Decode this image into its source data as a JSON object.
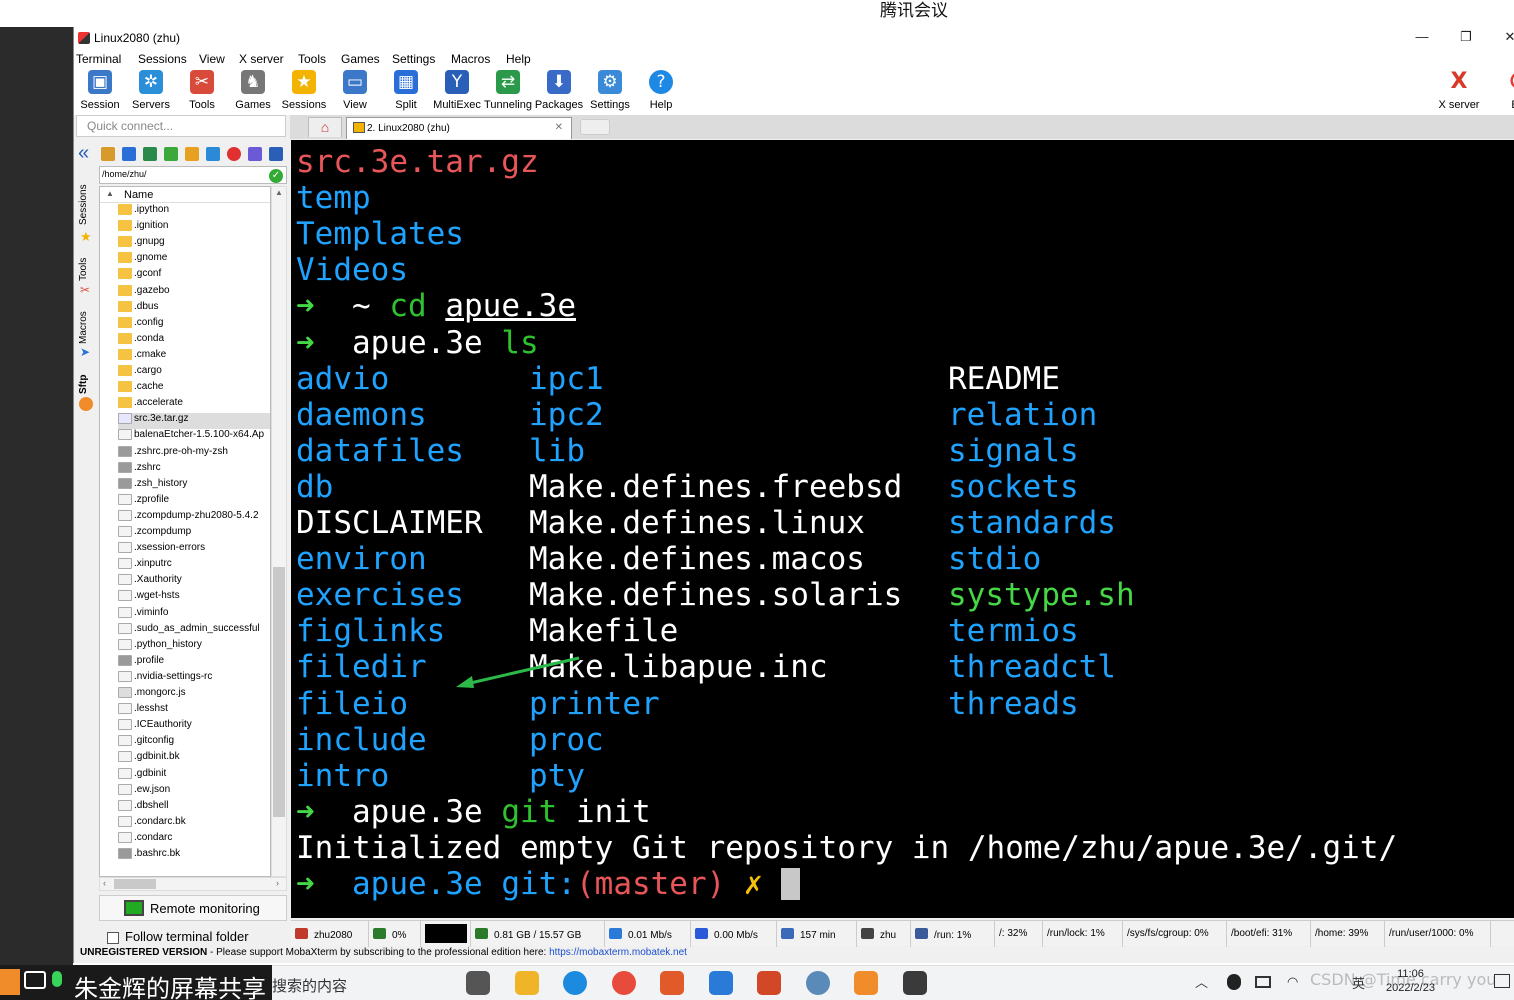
{
  "meeting": {
    "title": "腾讯会议"
  },
  "window": {
    "title": "Linux2080 (zhu)",
    "min": "—",
    "restore": "❐",
    "close": "✕"
  },
  "menu": [
    "Terminal",
    "Sessions",
    "View",
    "X server",
    "Tools",
    "Games",
    "Settings",
    "Macros",
    "Help"
  ],
  "toolbar": [
    {
      "label": "Session",
      "icon": "monitor-icon",
      "color": "#3b78c8",
      "glyph": "▣"
    },
    {
      "label": "Servers",
      "icon": "servers-icon",
      "color": "#2a8fd8",
      "glyph": "✲"
    },
    {
      "label": "Tools",
      "icon": "tools-icon",
      "color": "#d84a3a",
      "glyph": "✂"
    },
    {
      "label": "Games",
      "icon": "games-icon",
      "color": "#777777",
      "glyph": "♞"
    },
    {
      "label": "Sessions",
      "icon": "star-icon",
      "color": "#f2b400",
      "glyph": "★"
    },
    {
      "label": "View",
      "icon": "view-icon",
      "color": "#3b78c8",
      "glyph": "▭"
    },
    {
      "label": "Split",
      "icon": "split-icon",
      "color": "#2a6fd8",
      "glyph": "▦"
    },
    {
      "label": "MultiExec",
      "icon": "multiexec-icon",
      "color": "#2a5fb8",
      "glyph": "Y"
    },
    {
      "label": "Tunneling",
      "icon": "tunneling-icon",
      "color": "#2a9a4a",
      "glyph": "⇄"
    },
    {
      "label": "Packages",
      "icon": "packages-icon",
      "color": "#3a6ac8",
      "glyph": "⬇"
    },
    {
      "label": "Settings",
      "icon": "settings-icon",
      "color": "#3a8ad8",
      "glyph": "⚙"
    },
    {
      "label": "Help",
      "icon": "help-icon",
      "color": "#1e88e5",
      "glyph": "?"
    }
  ],
  "toolbar_right": [
    {
      "label": "X server",
      "icon": "xserver-icon",
      "glyph": "X",
      "color": "#d83a2a"
    },
    {
      "label": "Exi",
      "icon": "exit-icon",
      "glyph": "⏻",
      "color": "#e33b2e"
    }
  ],
  "quick_connect": {
    "placeholder": "Quick connect..."
  },
  "tabs": {
    "session_tab": "2. Linux2080 (zhu)",
    "close": "✕",
    "home": "⌂"
  },
  "side_tabs": [
    "Sessions",
    "Tools",
    "Macros",
    "Sftp"
  ],
  "sftp": {
    "path": "/home/zhu/",
    "column": "Name",
    "files": [
      {
        "name": ".ipython",
        "type": "folder"
      },
      {
        "name": ".ignition",
        "type": "folder"
      },
      {
        "name": ".gnupg",
        "type": "folder"
      },
      {
        "name": ".gnome",
        "type": "folder"
      },
      {
        "name": ".gconf",
        "type": "folder"
      },
      {
        "name": ".gazebo",
        "type": "folder"
      },
      {
        "name": ".dbus",
        "type": "folder"
      },
      {
        "name": ".config",
        "type": "folder"
      },
      {
        "name": ".conda",
        "type": "folder"
      },
      {
        "name": ".cmake",
        "type": "folder"
      },
      {
        "name": ".cargo",
        "type": "folder"
      },
      {
        "name": ".cache",
        "type": "folder"
      },
      {
        "name": ".accelerate",
        "type": "folder"
      },
      {
        "name": "src.3e.tar.gz",
        "type": "archive"
      },
      {
        "name": "balenaEtcher-1.5.100-x64.Ap",
        "type": "file"
      },
      {
        "name": ".zshrc.pre-oh-my-zsh",
        "type": "gray"
      },
      {
        "name": ".zshrc",
        "type": "gray"
      },
      {
        "name": ".zsh_history",
        "type": "gray"
      },
      {
        "name": ".zprofile",
        "type": "file"
      },
      {
        "name": ".zcompdump-zhu2080-5.4.2",
        "type": "file"
      },
      {
        "name": ".zcompdump",
        "type": "file"
      },
      {
        "name": ".xsession-errors",
        "type": "file"
      },
      {
        "name": ".xinputrc",
        "type": "file"
      },
      {
        "name": ".Xauthority",
        "type": "file"
      },
      {
        "name": ".wget-hsts",
        "type": "file"
      },
      {
        "name": ".viminfo",
        "type": "file"
      },
      {
        "name": ".sudo_as_admin_successful",
        "type": "file"
      },
      {
        "name": ".python_history",
        "type": "file"
      },
      {
        "name": ".profile",
        "type": "gray"
      },
      {
        "name": ".nvidia-settings-rc",
        "type": "file"
      },
      {
        "name": ".mongorc.js",
        "type": "js"
      },
      {
        "name": ".lesshst",
        "type": "file"
      },
      {
        "name": ".ICEauthority",
        "type": "file"
      },
      {
        "name": ".gitconfig",
        "type": "file"
      },
      {
        "name": ".gdbinit.bk",
        "type": "file"
      },
      {
        "name": ".gdbinit",
        "type": "file"
      },
      {
        "name": ".ew.json",
        "type": "file"
      },
      {
        "name": ".dbshell",
        "type": "file"
      },
      {
        "name": ".condarc.bk",
        "type": "file"
      },
      {
        "name": ".condarc",
        "type": "file"
      },
      {
        "name": ".bashrc.bk",
        "type": "gray"
      }
    ],
    "remote_monitoring": "Remote monitoring",
    "follow_folder": "Follow terminal folder"
  },
  "terminal": {
    "top_lines": [
      {
        "text": "src.3e.tar.gz",
        "color": "red"
      },
      {
        "text": "temp",
        "color": "cyan"
      },
      {
        "text": "Templates",
        "color": "cyan"
      },
      {
        "text": "Videos",
        "color": "cyan"
      }
    ],
    "prompt_arrow": "➜",
    "home_tilde": "~",
    "cd_cmd": "cd",
    "cd_arg": "apue.3e",
    "dir": "apue.3e",
    "ls_cmd": "ls",
    "ls_rows": [
      [
        {
          "t": "advio",
          "c": "cyan"
        },
        {
          "t": "ipc1",
          "c": "cyan"
        },
        {
          "t": "README",
          "c": "wht"
        }
      ],
      [
        {
          "t": "daemons",
          "c": "cyan"
        },
        {
          "t": "ipc2",
          "c": "cyan"
        },
        {
          "t": "relation",
          "c": "cyan"
        }
      ],
      [
        {
          "t": "datafiles",
          "c": "cyan"
        },
        {
          "t": "lib",
          "c": "cyan"
        },
        {
          "t": "signals",
          "c": "cyan"
        }
      ],
      [
        {
          "t": "db",
          "c": "cyan"
        },
        {
          "t": "Make.defines.freebsd",
          "c": "wht"
        },
        {
          "t": "sockets",
          "c": "cyan"
        }
      ],
      [
        {
          "t": "DISCLAIMER",
          "c": "wht"
        },
        {
          "t": "Make.defines.linux",
          "c": "wht"
        },
        {
          "t": "standards",
          "c": "cyan"
        }
      ],
      [
        {
          "t": "environ",
          "c": "cyan"
        },
        {
          "t": "Make.defines.macos",
          "c": "wht"
        },
        {
          "t": "stdio",
          "c": "cyan"
        }
      ],
      [
        {
          "t": "exercises",
          "c": "cyan"
        },
        {
          "t": "Make.defines.solaris",
          "c": "wht"
        },
        {
          "t": "systype.sh",
          "c": "grn"
        }
      ],
      [
        {
          "t": "figlinks",
          "c": "cyan"
        },
        {
          "t": "Makefile",
          "c": "wht"
        },
        {
          "t": "termios",
          "c": "cyan"
        }
      ],
      [
        {
          "t": "filedir",
          "c": "cyan"
        },
        {
          "t": "Make.libapue.inc",
          "c": "wht"
        },
        {
          "t": "threadctl",
          "c": "cyan"
        }
      ],
      [
        {
          "t": "fileio",
          "c": "cyan"
        },
        {
          "t": "printer",
          "c": "cyan"
        },
        {
          "t": "threads",
          "c": "cyan"
        }
      ],
      [
        {
          "t": "include",
          "c": "cyan"
        },
        {
          "t": "proc",
          "c": "cyan"
        },
        {
          "t": "",
          "c": "cyan"
        }
      ],
      [
        {
          "t": "intro",
          "c": "cyan"
        },
        {
          "t": "pty",
          "c": "cyan"
        },
        {
          "t": "",
          "c": "cyan"
        }
      ]
    ],
    "git_cmd": "git",
    "git_arg": "init",
    "init_output": "Initialized empty Git repository in /home/zhu/apue.3e/.git/",
    "git_label": "git:",
    "branch_open": "(",
    "branch": "master",
    "branch_close": ")",
    "dirty_mark": "✗"
  },
  "status": [
    {
      "label": "zhu2080",
      "icon": "host-icon",
      "color": "#c0392b",
      "w": 78
    },
    {
      "label": "0%",
      "icon": "cpu-icon",
      "color": "#2c7a2c",
      "w": 52
    },
    {
      "label": "",
      "icon": "cpu-graph",
      "color": "#000000",
      "w": 50
    },
    {
      "label": "0.81 GB / 15.57 GB",
      "icon": "memory-icon",
      "color": "#2a7a2a",
      "w": 134
    },
    {
      "label": "0.01 Mb/s",
      "icon": "upload-icon",
      "color": "#2a7ad8",
      "w": 86
    },
    {
      "label": "0.00 Mb/s",
      "icon": "download-icon",
      "color": "#2a5ad8",
      "w": 86
    },
    {
      "label": "157 min",
      "icon": "uptime-icon",
      "color": "#3a6ab8",
      "w": 80
    },
    {
      "label": "zhu",
      "icon": "user-icon",
      "color": "#444444",
      "w": 54
    },
    {
      "label": "/run: 1%",
      "icon": "disk-icon",
      "color": "#3a5a9a",
      "w": 84
    },
    {
      "label": "/: 32%",
      "icon": "",
      "color": "",
      "w": 48
    },
    {
      "label": "/run/lock: 1%",
      "icon": "",
      "color": "",
      "w": 80
    },
    {
      "label": "/sys/fs/cgroup: 0%",
      "icon": "",
      "color": "",
      "w": 104
    },
    {
      "label": "/boot/efi: 31%",
      "icon": "",
      "color": "",
      "w": 84
    },
    {
      "label": "/home: 39%",
      "icon": "",
      "color": "",
      "w": 74
    },
    {
      "label": "/run/user/1000: 0%",
      "icon": "",
      "color": "",
      "w": 106
    }
  ],
  "footer": {
    "unregistered": "UNREGISTERED VERSION",
    "support": " -  Please support MobaXterm by subscribing to the professional edition here: ",
    "link": "https://mobaxterm.mobatek.net"
  },
  "taskbar": {
    "share": "朱金辉的屏幕共享",
    "search": "搜索的内容",
    "watermark": "CSDN @Time carry you",
    "ime": "英",
    "time": "11:06",
    "date": "2022/2/23",
    "apps": [
      {
        "name": "taskview-icon",
        "color": "#555555"
      },
      {
        "name": "explorer-icon",
        "color": "#f0b429"
      },
      {
        "name": "edge-icon",
        "color": "#1b8adf"
      },
      {
        "name": "chrome-icon",
        "color": "#e84b3c"
      },
      {
        "name": "snip-icon",
        "color": "#e05a2a"
      },
      {
        "name": "photos-icon",
        "color": "#2a7ad8"
      },
      {
        "name": "powerpoint-icon",
        "color": "#d24726"
      },
      {
        "name": "chat-icon",
        "color": "#5a8ab8"
      },
      {
        "name": "office-icon",
        "color": "#f08c2a"
      },
      {
        "name": "mobaxterm-icon",
        "color": "#3a3a3a"
      }
    ]
  }
}
